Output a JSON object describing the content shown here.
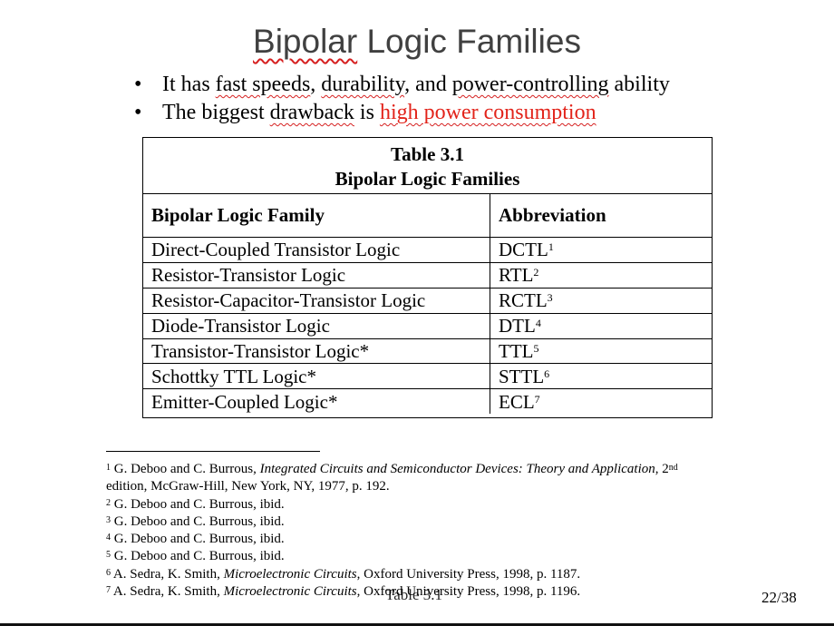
{
  "title": {
    "part1": "Bipolar",
    "part2": " Logic Families"
  },
  "bullets": {
    "b1": {
      "t1": "It has ",
      "u1": "fast speeds",
      "t2": ", ",
      "u2": "durability",
      "t3": ", and ",
      "u3": "power-controlling",
      "t4": " ability"
    },
    "b2": {
      "t1": "The biggest ",
      "u1": "drawback",
      "t2": " is ",
      "red": "high power consumption"
    }
  },
  "table": {
    "caption_line1": "Table 3.1",
    "caption_line2": "Bipolar Logic Families",
    "headers": [
      "Bipolar Logic Family",
      "Abbreviation"
    ],
    "rows": [
      {
        "family": "Direct-Coupled Transistor Logic",
        "abbr": "DCTL",
        "note": "1"
      },
      {
        "family": "Resistor-Transistor Logic",
        "abbr": "RTL",
        "note": "2"
      },
      {
        "family": "Resistor-Capacitor-Transistor Logic",
        "abbr": "RCTL",
        "note": "3"
      },
      {
        "family": "Diode-Transistor Logic",
        "abbr": "DTL",
        "note": "4"
      },
      {
        "family": "Transistor-Transistor Logic*",
        "abbr": "TTL",
        "note": "5"
      },
      {
        "family": "Schottky TTL Logic*",
        "abbr": "STTL",
        "note": "6"
      },
      {
        "family": "Emitter-Coupled Logic*",
        "abbr": "ECL",
        "note": "7"
      }
    ]
  },
  "footnotes": {
    "f1": {
      "num": "1",
      "pre": " G. Deboo and C. Burrous, ",
      "italic": "Integrated Circuits and Semiconductor Devices: Theory and Application",
      "mid": ", 2",
      "sup": "nd",
      "line2": "edition, McGraw-Hill, New York, NY, 1977, p. 192."
    },
    "f2": {
      "num": "2",
      "text": " G. Deboo and C. Burrous, ibid."
    },
    "f3": {
      "num": "3",
      "text": " G. Deboo and C. Burrous, ibid."
    },
    "f4": {
      "num": "4",
      "text": " G. Deboo and C. Burrous, ibid."
    },
    "f5": {
      "num": "5",
      "text": " G. Deboo and C. Burrous, ibid."
    },
    "f6": {
      "num": "6",
      "pre": " A. Sedra, K. Smith, ",
      "italic": "Microelectronic Circuits",
      "post": ", Oxford University Press, 1998, p. 1187."
    },
    "f7": {
      "num": "7",
      "pre": " A. Sedra, K. Smith, ",
      "italic": "Microelectronic Circuits",
      "post": ", Oxford University Press, 1998, p. 1196."
    }
  },
  "overlay_label": "Table 3.1",
  "page_number": "22/38",
  "colors": {
    "title": "#404040",
    "highlight_red": "#e2231a",
    "annotation_underline": "#d62020"
  }
}
